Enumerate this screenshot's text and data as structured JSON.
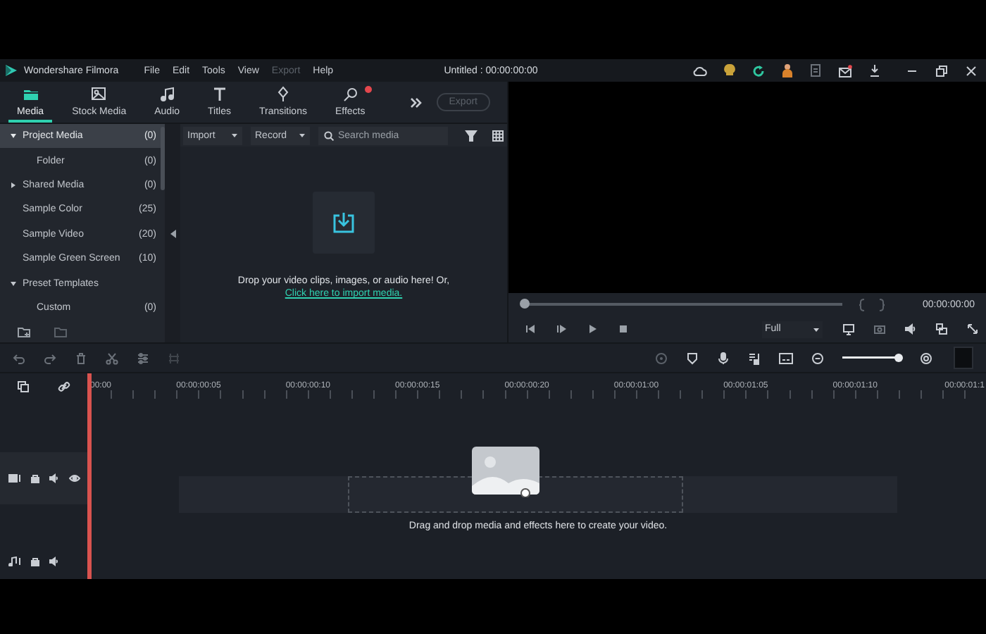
{
  "title_bar": {
    "app_name": "Wondershare Filmora",
    "menu": [
      {
        "label": "File",
        "disabled": false
      },
      {
        "label": "Edit",
        "disabled": false
      },
      {
        "label": "Tools",
        "disabled": false
      },
      {
        "label": "View",
        "disabled": false
      },
      {
        "label": "Export",
        "disabled": true
      },
      {
        "label": "Help",
        "disabled": false
      }
    ],
    "project_title": "Untitled : 00:00:00:00"
  },
  "media_tabs": [
    {
      "label": "Media",
      "selected": true,
      "badge": false
    },
    {
      "label": "Stock Media",
      "selected": false,
      "badge": false
    },
    {
      "label": "Audio",
      "selected": false,
      "badge": false
    },
    {
      "label": "Titles",
      "selected": false,
      "badge": false
    },
    {
      "label": "Transitions",
      "selected": false,
      "badge": false
    },
    {
      "label": "Effects",
      "selected": false,
      "badge": true
    }
  ],
  "export_button": {
    "label": "Export",
    "disabled": true
  },
  "library": {
    "items": [
      {
        "label": "Project Media",
        "count": "(0)",
        "expanded": true,
        "selected": true,
        "children": [
          {
            "label": "Folder",
            "count": "(0)",
            "selected": false
          }
        ]
      },
      {
        "label": "Shared Media",
        "count": "(0)",
        "expanded": false,
        "selected": false
      },
      {
        "label": "Sample Color",
        "count": "(25)",
        "selected": false
      },
      {
        "label": "Sample Video",
        "count": "(20)",
        "selected": false
      },
      {
        "label": "Sample Green Screen",
        "count": "(10)",
        "selected": false
      },
      {
        "label": "Preset Templates",
        "expanded": true,
        "selected": false,
        "children": [
          {
            "label": "Custom",
            "count": "(0)",
            "selected": false
          }
        ]
      }
    ]
  },
  "media_toolbar": {
    "import": "Import",
    "record": "Record",
    "search": {
      "placeholder": "Search media"
    }
  },
  "empty_media": {
    "message": "Drop your video clips, images, or audio here! Or,",
    "link": "Click here to import media."
  },
  "preview": {
    "progress": {
      "level": 0
    },
    "timecode": "00:00:00:00",
    "quality": "Full"
  },
  "timeline": {
    "zoom": {
      "level": 0.95
    },
    "ruler": [
      "00:00",
      "00:00:00:05",
      "00:00:00:10",
      "00:00:00:15",
      "00:00:00:20",
      "00:00:01:00",
      "00:00:01:05",
      "00:00:01:10",
      "00:00:01:1"
    ],
    "hint": "Drag and drop media and effects here to create your video."
  }
}
